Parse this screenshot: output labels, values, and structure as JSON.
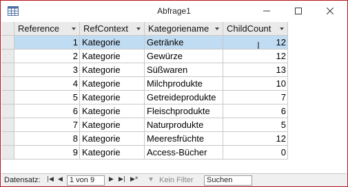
{
  "window": {
    "title": "Abfrage1",
    "icon": "table-icon",
    "controls": [
      "minimize-icon",
      "maximize-icon",
      "close-icon"
    ]
  },
  "grid": {
    "columns": [
      "Reference",
      "RefContext",
      "Kategoriename",
      "ChildCount"
    ],
    "rows": [
      {
        "reference": "1",
        "refcontext": "Kategorie",
        "kategoriename": "Getränke",
        "childcount": "12",
        "selected": true
      },
      {
        "reference": "2",
        "refcontext": "Kategorie",
        "kategoriename": "Gewürze",
        "childcount": "12"
      },
      {
        "reference": "3",
        "refcontext": "Kategorie",
        "kategoriename": "Süßwaren",
        "childcount": "13"
      },
      {
        "reference": "4",
        "refcontext": "Kategorie",
        "kategoriename": "Milchprodukte",
        "childcount": "10"
      },
      {
        "reference": "5",
        "refcontext": "Kategorie",
        "kategoriename": "Getreideprodukte",
        "childcount": "7"
      },
      {
        "reference": "6",
        "refcontext": "Kategorie",
        "kategoriename": "Fleischprodukte",
        "childcount": "6"
      },
      {
        "reference": "7",
        "refcontext": "Kategorie",
        "kategoriename": "Naturprodukte",
        "childcount": "5"
      },
      {
        "reference": "8",
        "refcontext": "Kategorie",
        "kategoriename": "Meeresfrüchte",
        "childcount": "12"
      },
      {
        "reference": "9",
        "refcontext": "Kategorie",
        "kategoriename": "Access-Bücher",
        "childcount": "0"
      }
    ]
  },
  "statusbar": {
    "label": "Datensatz:",
    "record": "1 von 9",
    "filter": "Kein Filter",
    "search": "Suchen"
  },
  "colors": {
    "window_border": "#b5121b",
    "selection": "#c0dcf3",
    "header_bg": "#eaeaea"
  }
}
